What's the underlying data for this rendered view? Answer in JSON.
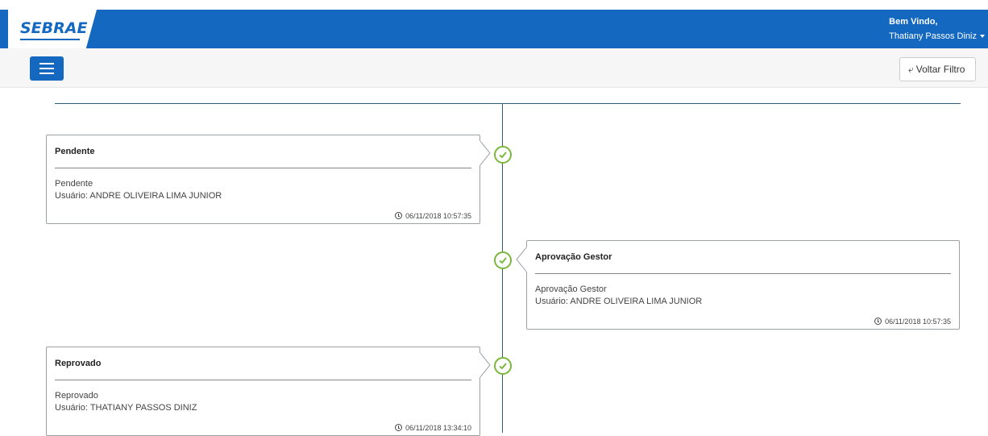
{
  "header": {
    "logo_text": "SEBRAE",
    "greeting": "Bem Vindo,",
    "user_name": "Thatiany Passos Diniz"
  },
  "toolbar": {
    "back_label": "Voltar Filtro"
  },
  "timeline": [
    {
      "title": "Pendente",
      "line1": "Pendente",
      "line2": "Usuário: ANDRE OLIVEIRA LIMA JUNIOR",
      "timestamp": "06/11/2018 10:57:35",
      "side": "left"
    },
    {
      "title": "Aprovação Gestor",
      "line1": "Aprovação Gestor",
      "line2": "Usuário: ANDRE OLIVEIRA LIMA JUNIOR",
      "timestamp": "06/11/2018 10:57:35",
      "side": "right"
    },
    {
      "title": "Reprovado",
      "line1": "Reprovado",
      "line2": "Usuário: THATIANY PASSOS DINIZ",
      "timestamp": "06/11/2018 13:34:10",
      "side": "left"
    }
  ],
  "colors": {
    "brand": "#1468c0",
    "check": "#7ab73c",
    "timeline_line": "#2e5c74"
  },
  "icons": [
    "menu-icon",
    "reply-arrow-icon",
    "check-icon",
    "clock-icon",
    "chevron-down-icon"
  ]
}
